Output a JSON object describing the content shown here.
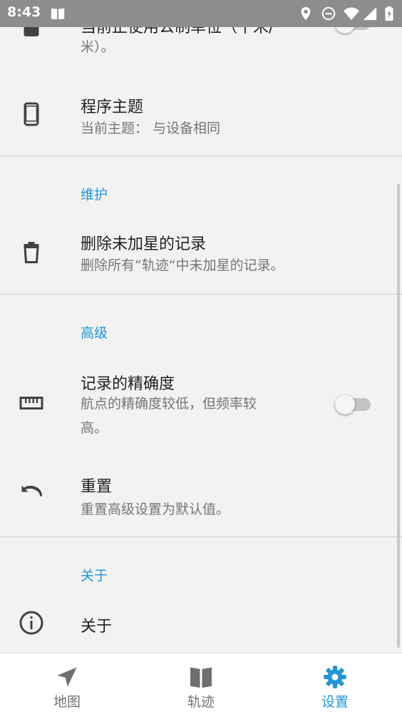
{
  "status_bar": {
    "time": "8:43",
    "icons": [
      "book-icon",
      "location-icon",
      "dnd-icon",
      "wifi-icon",
      "signal-icon",
      "battery-icon"
    ]
  },
  "colors": {
    "accent": "#2196d3",
    "status_bar": "#8d8d8d",
    "background": "#f2f2f2"
  },
  "settings": {
    "partial_item": {
      "title": "当前正使用公制单位（千米/",
      "summary": "米）。",
      "toggle_on": false
    },
    "theme": {
      "title": "程序主题",
      "summary": "当前主题： 与设备相同",
      "icon": "phone-icon"
    },
    "maintenance": {
      "header": "维护",
      "delete": {
        "title": "删除未加星的记录",
        "summary": "删除所有“轨迹“中未加星的记录。",
        "icon": "trash-icon"
      }
    },
    "advanced": {
      "header": "高级",
      "accuracy": {
        "title": "记录的精确度",
        "summary_line1": "航点的精确度较低，但频率较",
        "summary_line2": "高。",
        "icon": "ruler-icon",
        "toggle_on": false
      },
      "reset": {
        "title": "重置",
        "summary": "重置高级设置为默认值。",
        "icon": "undo-icon"
      }
    },
    "about": {
      "header": "关于",
      "item": {
        "title": "关于",
        "icon": "info-icon"
      }
    }
  },
  "bottom_nav": {
    "selected": "settings",
    "items": [
      {
        "label": "地图",
        "icon": "navigation-arrow-icon"
      },
      {
        "label": "轨迹",
        "icon": "book-icon"
      },
      {
        "label": "设置",
        "icon": "gear-icon"
      }
    ]
  }
}
